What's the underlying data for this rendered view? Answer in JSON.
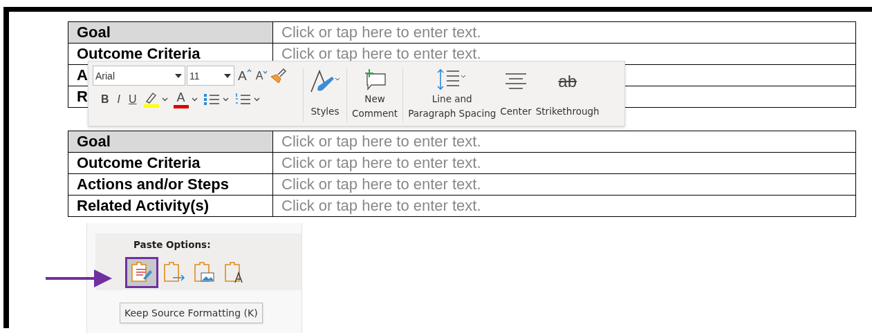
{
  "tables": [
    {
      "rows": [
        {
          "label": "Goal",
          "value": "Click or tap here to enter text.",
          "shaded": true
        },
        {
          "label": "Outcome Criteria",
          "value": "Click or tap here to enter text.",
          "shaded": false
        },
        {
          "label": "A",
          "shaded": false
        },
        {
          "label": "R",
          "shaded": false
        }
      ]
    },
    {
      "rows": [
        {
          "label": "Goal",
          "value": "Click or tap here to enter text.",
          "shaded": true
        },
        {
          "label": "Outcome Criteria",
          "value": "Click or tap here to enter text.",
          "shaded": false
        },
        {
          "label": "Actions and/or Steps",
          "value": "Click or tap here to enter text.",
          "shaded": false
        },
        {
          "label": "Related Activity(s)",
          "value": "Click or tap here to enter text.",
          "shaded": false
        }
      ]
    }
  ],
  "toolbar": {
    "font": {
      "value": "Arial"
    },
    "size": {
      "value": "11"
    },
    "grow_glyph": "A",
    "shrink_glyph": "A",
    "bold_glyph": "B",
    "italic_glyph": "I",
    "underline_glyph": "U",
    "font_color_glyph": "A",
    "buttons": [
      {
        "kind": "styles",
        "lines": [
          "Styles"
        ]
      },
      {
        "kind": "comment",
        "lines": [
          "New",
          "Comment"
        ]
      },
      {
        "kind": "spacing",
        "lines": [
          "Line and",
          "Paragraph Spacing"
        ]
      },
      {
        "kind": "center",
        "lines": [
          "Center"
        ]
      },
      {
        "kind": "strike",
        "lines": [
          "Strikethrough"
        ],
        "glyph": "ab"
      }
    ]
  },
  "paste_menu": {
    "title": "Paste Options:",
    "options": [
      {
        "kind": "keep",
        "selected": true
      },
      {
        "kind": "merge",
        "selected": false
      },
      {
        "kind": "picture",
        "selected": false
      },
      {
        "kind": "text",
        "selected": false
      }
    ],
    "tooltip": "Keep Source Formatting (K)"
  }
}
